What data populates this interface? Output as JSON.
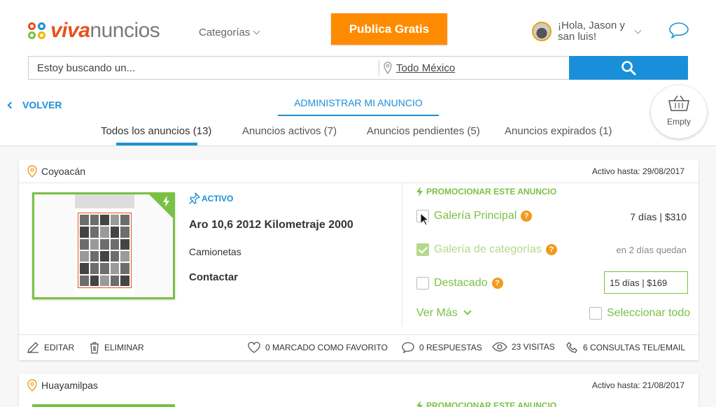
{
  "header": {
    "logo_brand": "viva",
    "logo_rest": "nuncios",
    "categories_label": "Categorías",
    "publish_button": "Publica Gratis",
    "greeting": "¡Hola, Jason y san luis!"
  },
  "search": {
    "placeholder": "Estoy buscando un...",
    "location": "Todo México"
  },
  "nav": {
    "back_label": "VOLVER",
    "admin_label": "ADMINISTRAR MI ANUNCIO",
    "cart_label": "Empty"
  },
  "tabs": [
    {
      "label": "Todos los anuncios (13)",
      "active": true
    },
    {
      "label": "Anuncios activos (7)",
      "active": false
    },
    {
      "label": "Anuncios pendientes (5)",
      "active": false
    },
    {
      "label": "Anuncios expirados (1)",
      "active": false
    }
  ],
  "listing": {
    "location": "Coyoacán",
    "active_until": "Activo hasta: 29/08/2017",
    "status": "ACTIVO",
    "title": "Aro 10,6 2012 Kilometraje 2000",
    "category": "Camionetas",
    "contact": "Contactar",
    "promo": {
      "heading": "PROMOCIONAR ESTE ANUNCIO",
      "options": [
        {
          "label": "Galería Principal",
          "price": "7 días | $310",
          "checked": false,
          "disabled": false
        },
        {
          "label": "Galería de categorías",
          "price": "en 2 días quedan",
          "checked": true,
          "disabled": true
        },
        {
          "label": "Destacado",
          "price": "15 días | $169",
          "checked": false,
          "disabled": false
        }
      ],
      "help_glyph": "?",
      "see_more": "Ver Más",
      "select_all": "Seleccionar todo"
    },
    "footer": {
      "edit": "EDITAR",
      "delete": "ELIMINAR",
      "favorites": "0 MARCADO COMO FAVORITO",
      "replies": "0 RESPUESTAS",
      "visits": "23 VISITAS",
      "calls": "6 CONSULTAS TEL/EMAIL"
    }
  },
  "listing2": {
    "location": "Huayamilpas",
    "active_until": "Activo hasta: 21/08/2017",
    "promo_heading": "PROMOCIONAR ESTE ANUNCIO"
  },
  "colors": {
    "brand_orange": "#ff8c00",
    "accent_blue": "#1a8fd9",
    "promo_green": "#7ac143",
    "help_orange": "#f29a1f"
  }
}
